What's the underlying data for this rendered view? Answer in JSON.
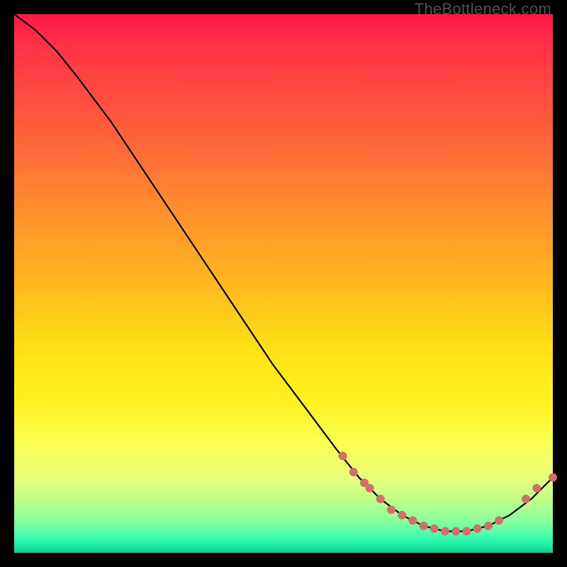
{
  "watermark": "TheBottleneck.com",
  "chart_data": {
    "type": "line",
    "title": "",
    "xlabel": "",
    "ylabel": "",
    "xlim": [
      0,
      100
    ],
    "ylim": [
      0,
      100
    ],
    "series": [
      {
        "name": "curve",
        "x": [
          0,
          4,
          8,
          12,
          18,
          24,
          30,
          36,
          42,
          48,
          54,
          60,
          64,
          68,
          72,
          76,
          80,
          84,
          88,
          92,
          96,
          100
        ],
        "y": [
          100,
          97,
          93,
          88,
          80,
          71,
          62,
          53,
          44,
          35,
          27,
          19,
          14,
          10,
          7,
          5,
          4,
          4,
          5,
          7,
          10,
          14
        ]
      }
    ],
    "markers": [
      {
        "x": 61,
        "y": 18
      },
      {
        "x": 63,
        "y": 15
      },
      {
        "x": 65,
        "y": 13
      },
      {
        "x": 66,
        "y": 12
      },
      {
        "x": 68,
        "y": 10
      },
      {
        "x": 70,
        "y": 8
      },
      {
        "x": 72,
        "y": 7
      },
      {
        "x": 74,
        "y": 6
      },
      {
        "x": 76,
        "y": 5
      },
      {
        "x": 78,
        "y": 4.5
      },
      {
        "x": 80,
        "y": 4
      },
      {
        "x": 82,
        "y": 4
      },
      {
        "x": 84,
        "y": 4
      },
      {
        "x": 86,
        "y": 4.5
      },
      {
        "x": 88,
        "y": 5
      },
      {
        "x": 90,
        "y": 6
      },
      {
        "x": 95,
        "y": 10
      },
      {
        "x": 97,
        "y": 12
      },
      {
        "x": 100,
        "y": 14
      }
    ],
    "marker_color": "#d66d66",
    "curve_color": "#000000"
  }
}
